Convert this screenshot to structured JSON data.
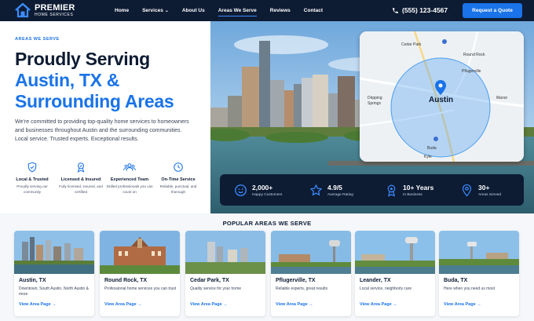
{
  "brand": {
    "name": "PREMIER",
    "sub": "HOME SERVICES"
  },
  "nav": {
    "items": [
      {
        "label": "Home"
      },
      {
        "label": "Services"
      },
      {
        "label": "About Us"
      },
      {
        "label": "Areas We Serve"
      },
      {
        "label": "Reviews"
      },
      {
        "label": "Contact"
      }
    ],
    "phone": "(555) 123-4567",
    "cta": "Request a Quote",
    "active": "Areas We Serve"
  },
  "hero": {
    "eyebrow": "AREAS WE SERVE",
    "title_line1": "Proudly Serving",
    "title_line2": "Austin, TX &",
    "title_line3": "Surrounding Areas",
    "lead": "We’re committed to providing top-quality home services to homeowners and businesses throughout Austin and the surrounding communities. Local service. Trusted experts. Exceptional results.",
    "features": [
      {
        "title": "Local & Trusted",
        "desc": "Proudly serving our community",
        "icon": "shield-check-icon"
      },
      {
        "title": "Licensed & Insured",
        "desc": "Fully licensed, insured, and certified",
        "icon": "badge-icon"
      },
      {
        "title": "Experienced Team",
        "desc": "Skilled professionals you can count on",
        "icon": "team-icon"
      },
      {
        "title": "On-Time Service",
        "desc": "Reliable, punctual, and thorough",
        "icon": "clock-icon"
      }
    ]
  },
  "map": {
    "center": "Austin",
    "labels": [
      "Cedar Park",
      "Round Rock",
      "Pflugerville",
      "Dripping Springs",
      "Manor",
      "Buda",
      "Kyle"
    ]
  },
  "stats": [
    {
      "value": "2,000+",
      "label": "Happy Customers",
      "icon": "smile-icon"
    },
    {
      "value": "4.9/5",
      "label": "Average Rating",
      "icon": "star-icon"
    },
    {
      "value": "10+ Years",
      "label": "In Business",
      "icon": "award-icon"
    },
    {
      "value": "30+",
      "label": "Areas Served",
      "icon": "map-pin-icon"
    }
  ],
  "areas": {
    "title": "POPULAR AREAS WE SERVE",
    "link_label": "View Area Page",
    "cards": [
      {
        "name": "Austin, TX",
        "desc": "Downtown, South Austin, North Austin & more"
      },
      {
        "name": "Round Rock, TX",
        "desc": "Professional home services you can trust"
      },
      {
        "name": "Cedar Park, TX",
        "desc": "Quality service for your home"
      },
      {
        "name": "Pflugerville, TX",
        "desc": "Reliable experts, great results"
      },
      {
        "name": "Leander, TX",
        "desc": "Local service, neighborly care"
      },
      {
        "name": "Buda, TX",
        "desc": "Here when you need us most"
      }
    ]
  },
  "colors": {
    "navy": "#0d1b33",
    "accent": "#1a73e8",
    "bg_alt": "#f5f7fa"
  }
}
